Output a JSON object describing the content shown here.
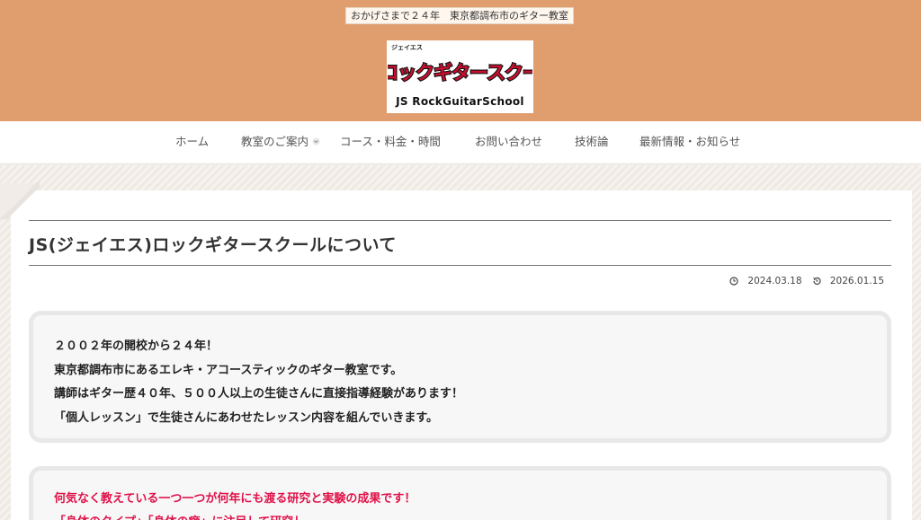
{
  "header": {
    "tagline": "おかげさまで２４年　東京都調布市のギター教室",
    "logo": {
      "small_text": "ジェイエス",
      "main_text": "JSロックギタースクール",
      "sub_text": "JS RockGuitarSchool"
    },
    "background_color": "#e09e6f"
  },
  "nav": {
    "items": [
      {
        "label": "ホーム"
      },
      {
        "label": "教室のご案内"
      },
      {
        "label": "コース・料金・時間"
      },
      {
        "label": "お問い合わせ"
      },
      {
        "label": "技術論"
      },
      {
        "label": "最新情報・お知らせ"
      }
    ],
    "dropdown_icon": "chevron-down-icon"
  },
  "article": {
    "title": "JS(ジェイエス)ロックギタースクールについて",
    "published": "2024.03.18",
    "updated": "2026.01.15",
    "published_icon": "clock-icon",
    "updated_icon": "history-icon"
  },
  "intro_box": {
    "lines": [
      "２００２年の開校から２４年！",
      "東京都調布市にあるエレキ・アコースティックのギター教室です。",
      "講師はギター歴４０年、５００人以上の生徒さんに直接指導経験があります！",
      "「個人レッスン」で生徒さんにあわせたレッスン内容を組んでいきます。"
    ]
  },
  "highlight_box": {
    "lines": [
      "何気なく教えている一つ一つが何年にも渡る研究と実験の成果です！",
      "「身体のタイプ」「身体の癖」に注目して研究し"
    ],
    "text_color": "#e0124a"
  }
}
